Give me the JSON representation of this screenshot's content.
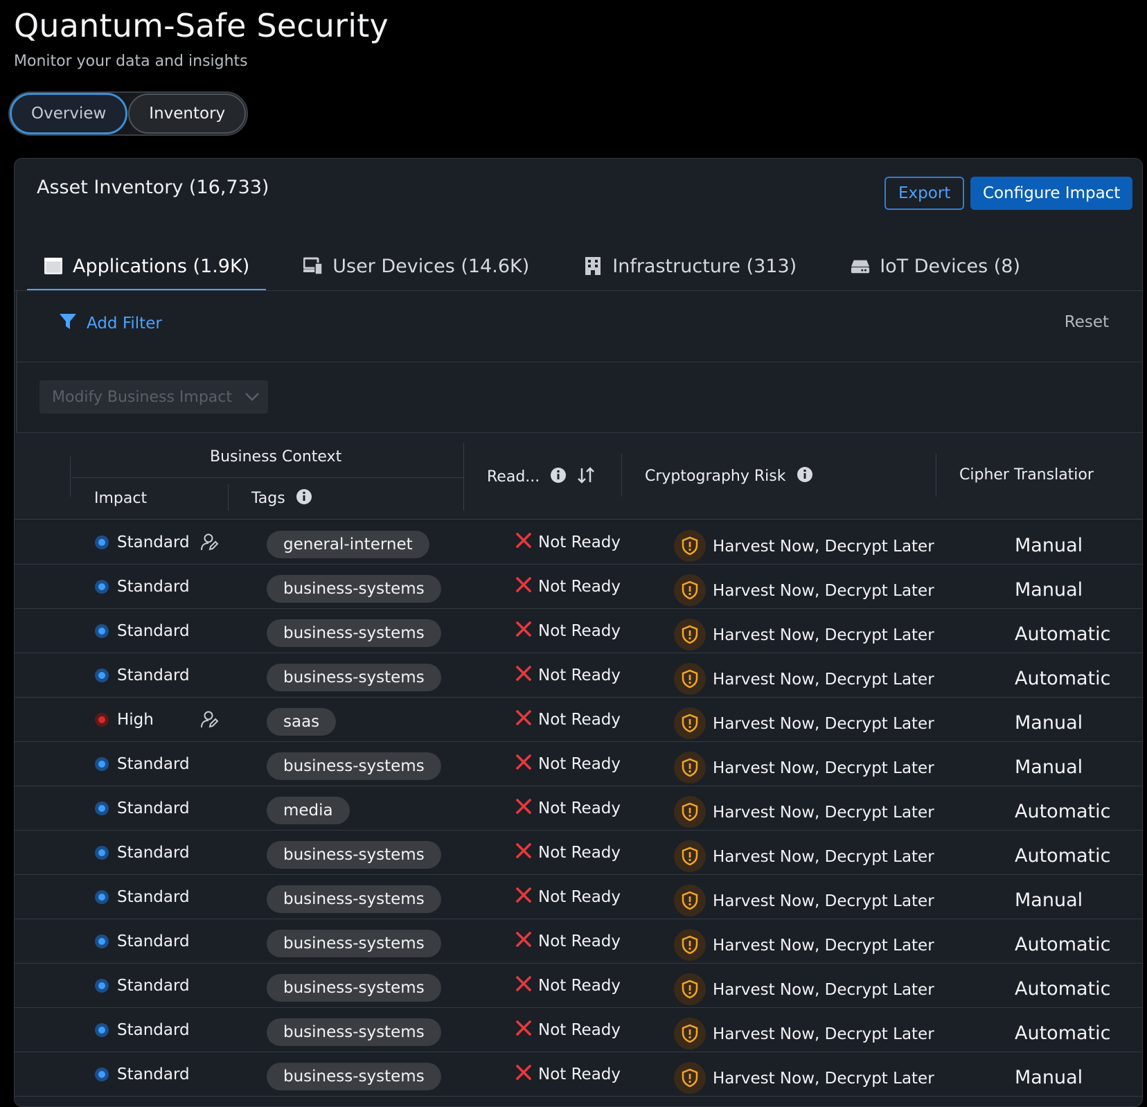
{
  "header": {
    "title": "Quantum-Safe Security",
    "subtitle": "Monitor your data and insights"
  },
  "view_switch": {
    "overview": "Overview",
    "inventory": "Inventory"
  },
  "card": {
    "title": "Asset Inventory (16,733)",
    "export": "Export",
    "configure": "Configure Impact"
  },
  "tabs": [
    {
      "label": "Applications (1.9K)",
      "icon": "application-window-icon"
    },
    {
      "label": "User Devices (14.6K)",
      "icon": "devices-icon"
    },
    {
      "label": "Infrastructure (313)",
      "icon": "building-icon"
    },
    {
      "label": "IoT Devices (8)",
      "icon": "iot-device-icon"
    }
  ],
  "filter": {
    "add": "Add Filter",
    "reset": "Reset"
  },
  "modify": "Modify Business Impact",
  "table": {
    "group": "Business Context",
    "col_impact": "Impact",
    "col_tags": "Tags",
    "col_ready": "Read...",
    "col_risk": "Cryptography Risk",
    "col_cipher": "Cipher Translatior",
    "rows": [
      {
        "impact": "Standard",
        "level": "standard",
        "edit": true,
        "tag": "general-internet",
        "ready": "Not Ready",
        "risk": "Harvest Now, Decrypt Later",
        "cipher": "Manual"
      },
      {
        "impact": "Standard",
        "level": "standard",
        "edit": false,
        "tag": "business-systems",
        "ready": "Not Ready",
        "risk": "Harvest Now, Decrypt Later",
        "cipher": "Manual"
      },
      {
        "impact": "Standard",
        "level": "standard",
        "edit": false,
        "tag": "business-systems",
        "ready": "Not Ready",
        "risk": "Harvest Now, Decrypt Later",
        "cipher": "Automatic"
      },
      {
        "impact": "Standard",
        "level": "standard",
        "edit": false,
        "tag": "business-systems",
        "ready": "Not Ready",
        "risk": "Harvest Now, Decrypt Later",
        "cipher": "Automatic"
      },
      {
        "impact": "High",
        "level": "high",
        "edit": true,
        "tag": "saas",
        "ready": "Not Ready",
        "risk": "Harvest Now, Decrypt Later",
        "cipher": "Manual"
      },
      {
        "impact": "Standard",
        "level": "standard",
        "edit": false,
        "tag": "business-systems",
        "ready": "Not Ready",
        "risk": "Harvest Now, Decrypt Later",
        "cipher": "Manual"
      },
      {
        "impact": "Standard",
        "level": "standard",
        "edit": false,
        "tag": "media",
        "ready": "Not Ready",
        "risk": "Harvest Now, Decrypt Later",
        "cipher": "Automatic"
      },
      {
        "impact": "Standard",
        "level": "standard",
        "edit": false,
        "tag": "business-systems",
        "ready": "Not Ready",
        "risk": "Harvest Now, Decrypt Later",
        "cipher": "Automatic"
      },
      {
        "impact": "Standard",
        "level": "standard",
        "edit": false,
        "tag": "business-systems",
        "ready": "Not Ready",
        "risk": "Harvest Now, Decrypt Later",
        "cipher": "Manual"
      },
      {
        "impact": "Standard",
        "level": "standard",
        "edit": false,
        "tag": "business-systems",
        "ready": "Not Ready",
        "risk": "Harvest Now, Decrypt Later",
        "cipher": "Automatic"
      },
      {
        "impact": "Standard",
        "level": "standard",
        "edit": false,
        "tag": "business-systems",
        "ready": "Not Ready",
        "risk": "Harvest Now, Decrypt Later",
        "cipher": "Automatic"
      },
      {
        "impact": "Standard",
        "level": "standard",
        "edit": false,
        "tag": "business-systems",
        "ready": "Not Ready",
        "risk": "Harvest Now, Decrypt Later",
        "cipher": "Automatic"
      },
      {
        "impact": "Standard",
        "level": "standard",
        "edit": false,
        "tag": "business-systems",
        "ready": "Not Ready",
        "risk": "Harvest Now, Decrypt Later",
        "cipher": "Manual"
      }
    ]
  },
  "colors": {
    "accent": "#4aa3ff",
    "primary_button": "#0b5fb8",
    "standard": "#3c9dff",
    "high": "#e0262b",
    "not_ready": "#e5393d",
    "risk": "#f5a623"
  }
}
